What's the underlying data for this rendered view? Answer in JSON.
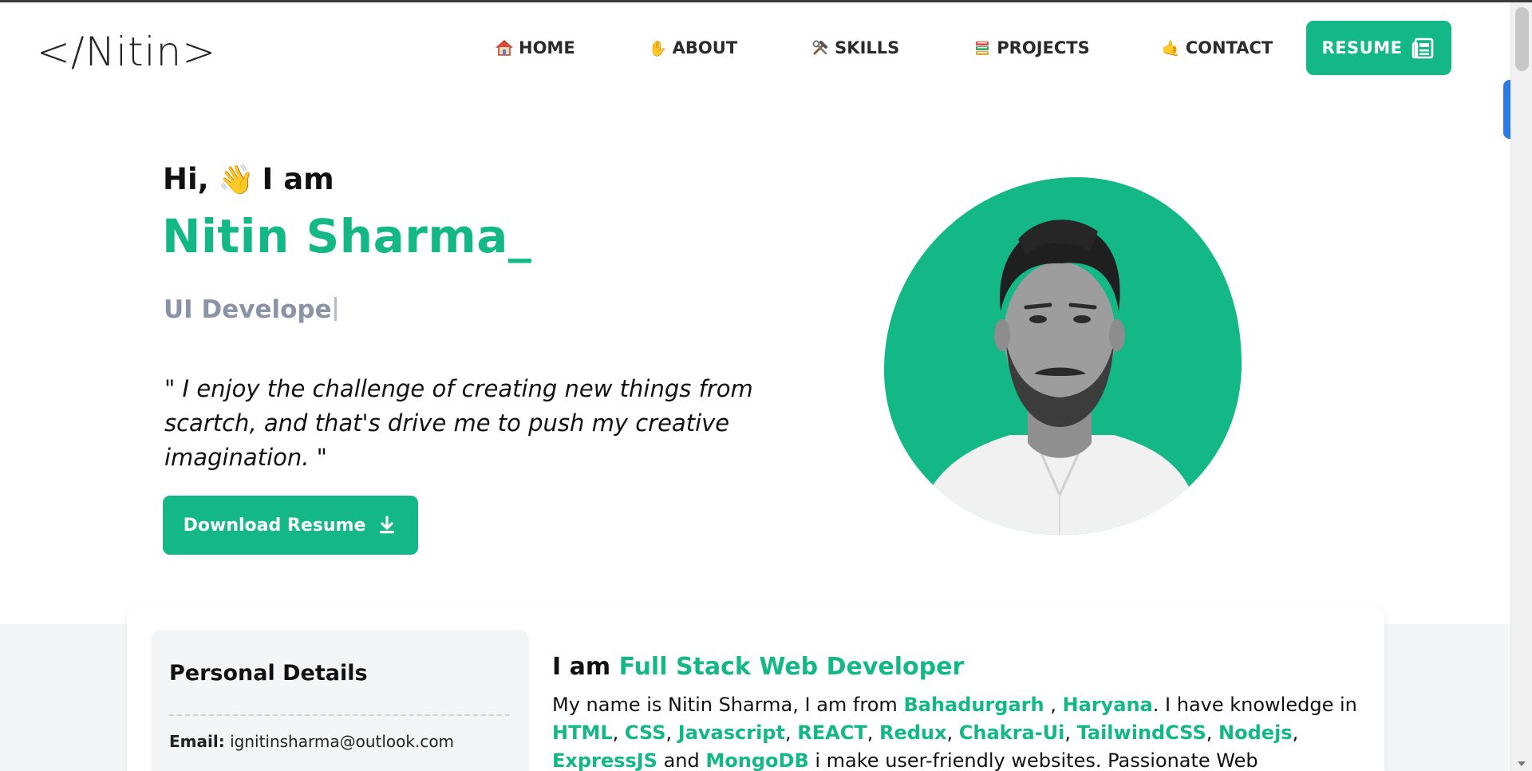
{
  "colors": {
    "accent": "#14b886",
    "muted_text": "#8a94a6",
    "background_band": "#f4f5f7"
  },
  "logo": {
    "text": "</Nitin>"
  },
  "nav": {
    "items": [
      {
        "label": "HOME",
        "icon": "house-icon"
      },
      {
        "label": "ABOUT",
        "icon": "waving-hand-icon"
      },
      {
        "label": "SKILLS",
        "icon": "tools-icon"
      },
      {
        "label": "PROJECTS",
        "icon": "books-icon"
      },
      {
        "label": "CONTACT",
        "icon": "call-me-hand-icon"
      }
    ],
    "resume_label": "RESUME",
    "resume_icon": "document-icon"
  },
  "hero": {
    "greeting_before": "Hi,",
    "greeting_after": "I am",
    "name": "Nitin Sharma_",
    "typed_role": "UI Develope",
    "quote": "\" I enjoy the challenge of creating new things from scartch, and that's drive me to push my creative imagination. \"",
    "download_label": "Download Resume",
    "download_icon": "download-icon",
    "photo_icon": "profile-photo"
  },
  "personal_details": {
    "title": "Personal Details",
    "email_label": "Email:",
    "email_value": "ignitinsharma@outlook.com"
  },
  "about": {
    "head_prefix": "I am",
    "head_accent": "Full Stack Web Developer",
    "p_1": "My name is Nitin Sharma, I am from",
    "city": "Bahadurgarh",
    "sep_1": " ,",
    "state": "Haryana",
    "p_2": ". I have knowledge in",
    "skills": [
      "HTML",
      "CSS",
      "Javascript",
      "REACT",
      "Redux",
      "Chakra-Ui",
      "TailwindCSS",
      "Nodejs",
      "ExpressJS"
    ],
    "comma": ",",
    "and": "and",
    "last_skill": "MongoDB",
    "p_3": "i make user-friendly websites. Passionate Web Developer with skills"
  }
}
